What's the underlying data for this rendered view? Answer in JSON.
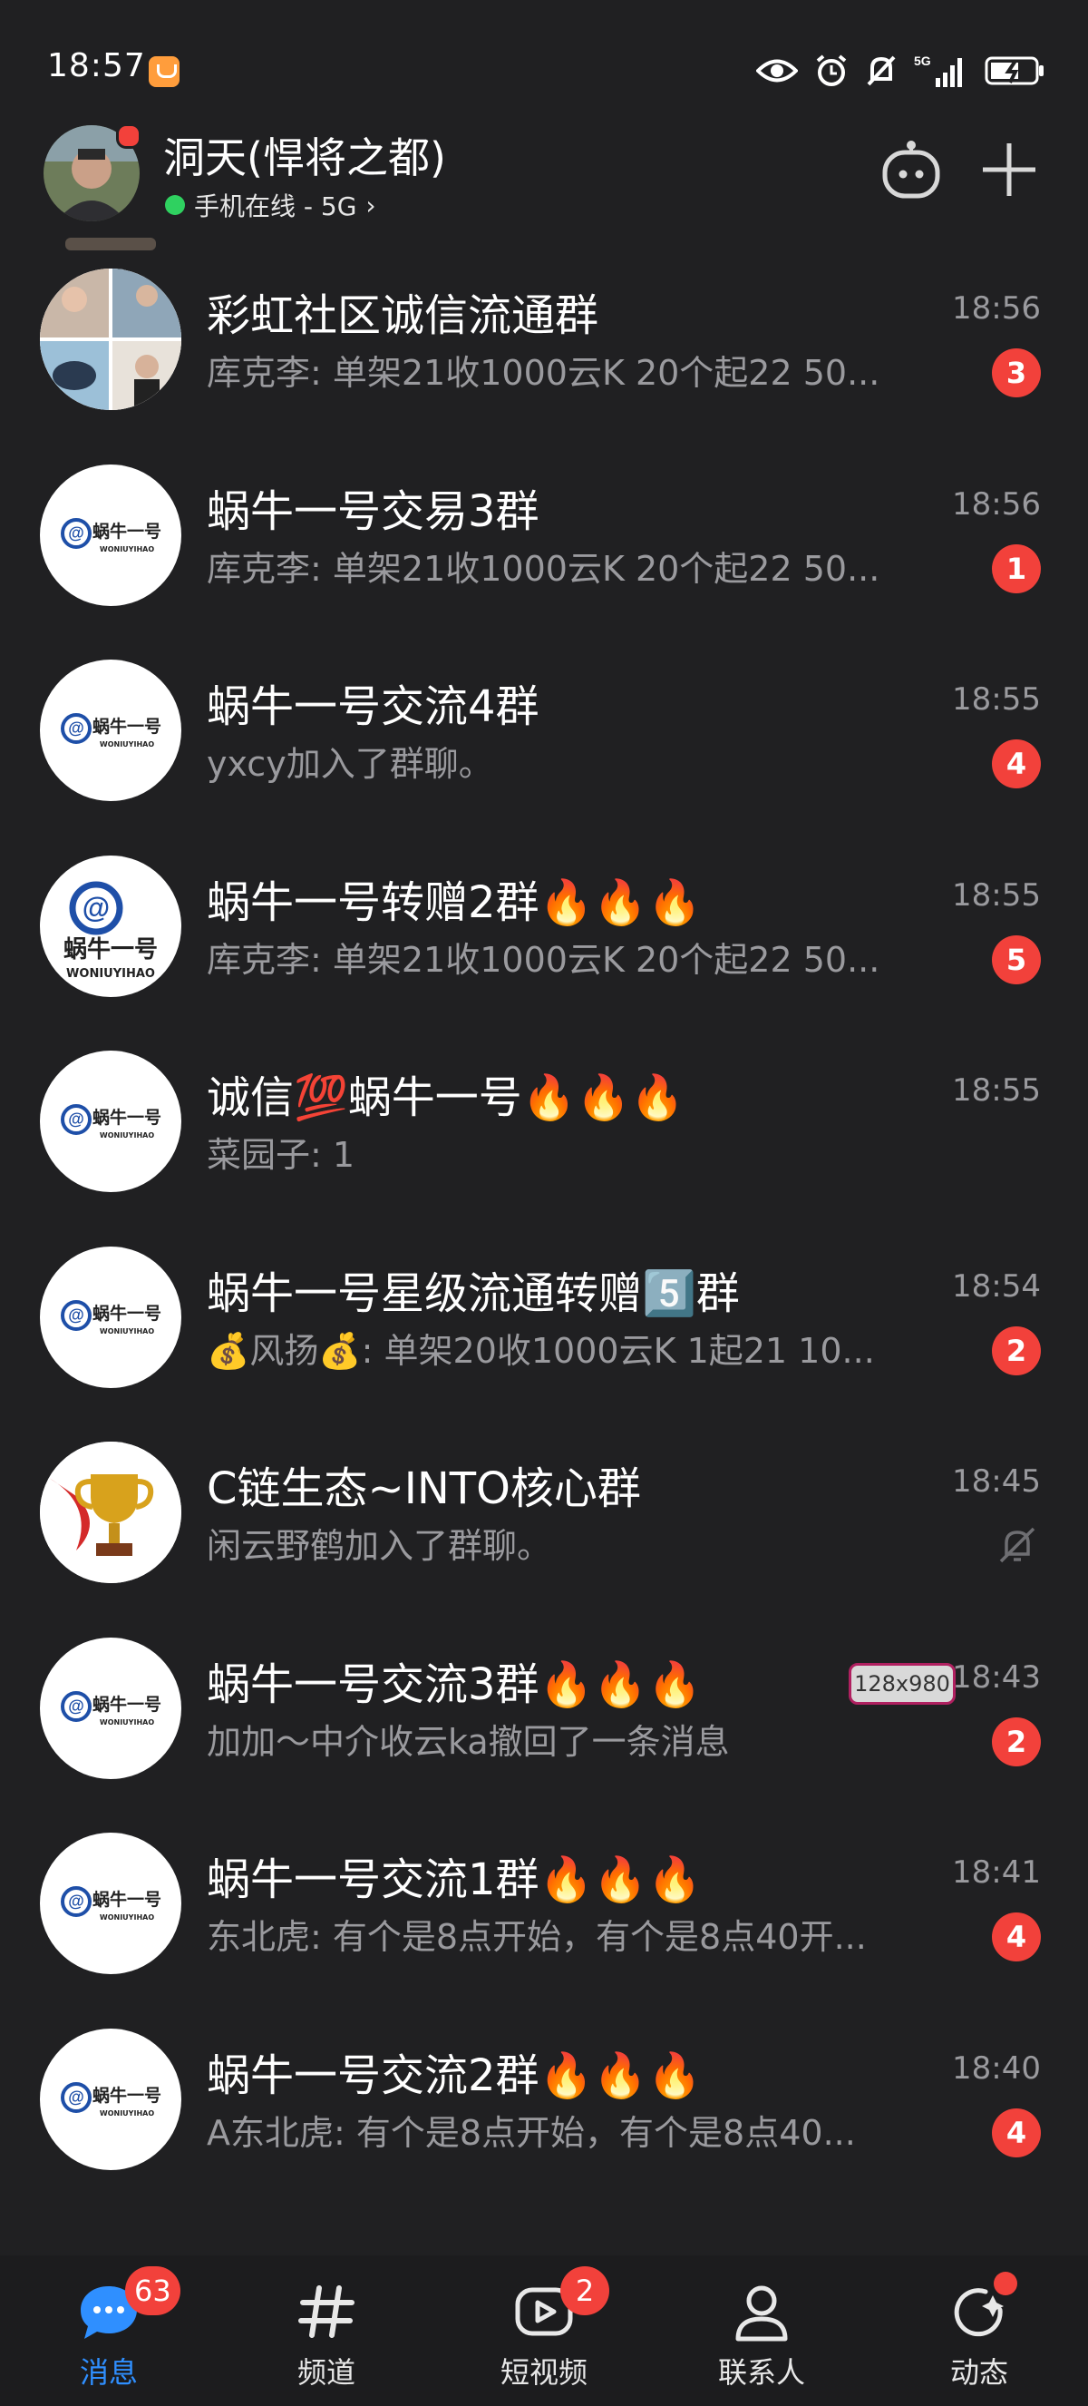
{
  "status_bar": {
    "time": "18:57",
    "network": "5G"
  },
  "header": {
    "user_name": "洞天(悍将之都)",
    "online_status": "手机在线 - 5G",
    "chevron": "›"
  },
  "sticker_text": "128x980",
  "conversations": [
    {
      "name": "彩虹社区诚信流通群",
      "preview": "库克李: 单架21收1000云K 20个起22 50...",
      "time": "18:56",
      "unread": "3",
      "avatar": "photo-collage",
      "muted": false
    },
    {
      "name": "蜗牛一号交易3群",
      "preview": "库克李: 单架21收1000云K 20个起22 50...",
      "time": "18:56",
      "unread": "1",
      "avatar": "snail-logo",
      "muted": false
    },
    {
      "name": "蜗牛一号交流4群",
      "preview": "yxcy加入了群聊。",
      "time": "18:55",
      "unread": "4",
      "avatar": "snail-logo",
      "muted": false
    },
    {
      "name": "蜗牛一号转赠2群🔥🔥🔥",
      "preview": "库克李: 单架21收1000云K 20个起22 50...",
      "time": "18:55",
      "unread": "5",
      "avatar": "snail-logo-large",
      "muted": false
    },
    {
      "name": "诚信💯蜗牛一号🔥🔥🔥",
      "preview": "菜园子: 1",
      "time": "18:55",
      "unread": "",
      "avatar": "snail-logo",
      "muted": false
    },
    {
      "name": "蜗牛一号星级流通转赠5️⃣群",
      "preview": "💰风扬💰: 单架20收1000云K 1起21 10...",
      "time": "18:54",
      "unread": "2",
      "avatar": "snail-logo",
      "muted": false
    },
    {
      "name": "C链生态~INTO核心群",
      "preview": "闲云野鹤加入了群聊。",
      "time": "18:45",
      "unread": "",
      "avatar": "trophy",
      "muted": true
    },
    {
      "name": "蜗牛一号交流3群🔥🔥🔥",
      "preview": "加加～中介收云ka撤回了一条消息",
      "time": "18:43",
      "unread": "2",
      "avatar": "snail-logo",
      "muted": false,
      "sticker": true
    },
    {
      "name": "蜗牛一号交流1群🔥🔥🔥",
      "preview": "东北虎: 有个是8点开始，有个是8点40开...",
      "time": "18:41",
      "unread": "4",
      "avatar": "snail-logo",
      "muted": false
    },
    {
      "name": "蜗牛一号交流2群🔥🔥🔥",
      "preview": "A东北虎: 有个是8点开始，有个是8点40...",
      "time": "18:40",
      "unread": "4",
      "avatar": "snail-logo",
      "muted": false
    }
  ],
  "logo_text": {
    "cn": "蜗牛一号",
    "en": "WONIUYIHAO"
  },
  "tabs": [
    {
      "label": "消息",
      "badge": "63",
      "icon": "chat-bubble-icon",
      "active": true
    },
    {
      "label": "频道",
      "badge": "",
      "icon": "hash-icon",
      "active": false
    },
    {
      "label": "短视频",
      "badge": "2",
      "icon": "video-icon",
      "active": false
    },
    {
      "label": "联系人",
      "badge": "",
      "icon": "person-icon",
      "active": false
    },
    {
      "label": "动态",
      "badge": "dot",
      "icon": "refresh-star-icon",
      "active": false
    }
  ],
  "colors": {
    "background": "#202022",
    "badge": "#f2413b",
    "accent_blue": "#2f8fff",
    "online_green": "#2fd160"
  }
}
